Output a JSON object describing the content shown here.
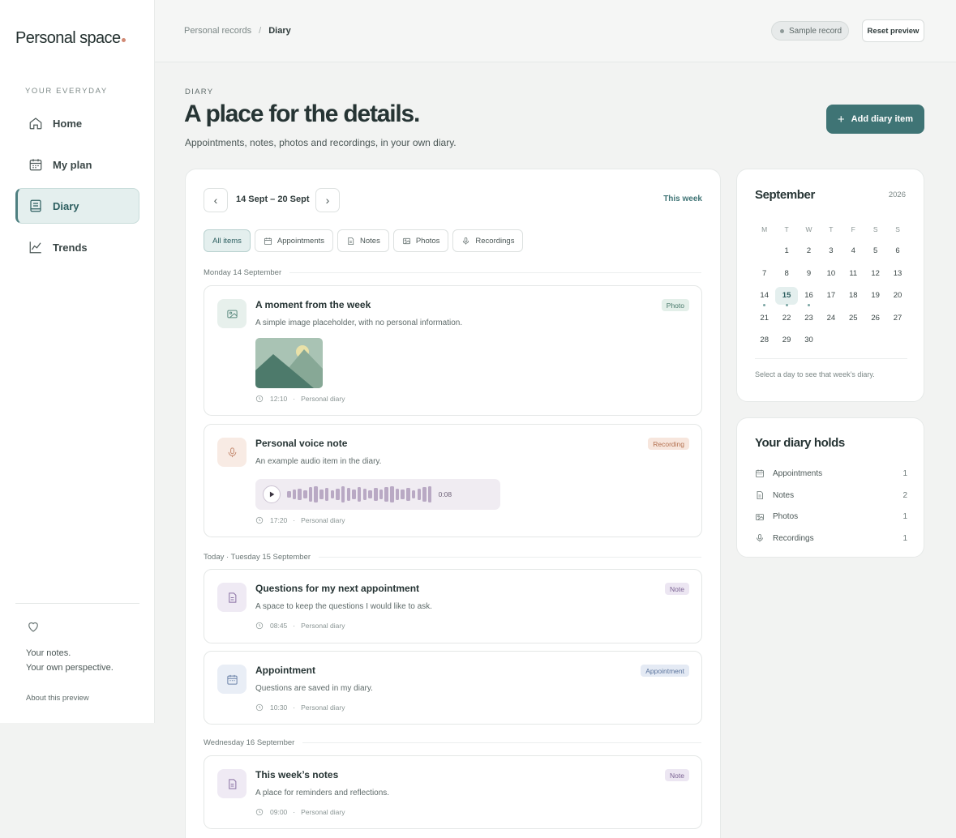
{
  "brand": "Personal space",
  "sidebar": {
    "section_label": "YOUR EVERYDAY",
    "items": [
      {
        "label": "Home",
        "icon": "home-icon"
      },
      {
        "label": "My plan",
        "icon": "calendar-icon"
      },
      {
        "label": "Diary",
        "icon": "book-icon",
        "active": true
      },
      {
        "label": "Trends",
        "icon": "chart-icon"
      }
    ],
    "quote_line1": "Your notes.",
    "quote_line2": "Your own perspective.",
    "about": "About this preview"
  },
  "topbar": {
    "crumb_parent": "Personal records",
    "crumb_sep": "/",
    "crumb_current": "Diary",
    "sample_badge": "Sample record",
    "reset": "Reset preview"
  },
  "header": {
    "eyebrow": "DIARY",
    "title": "A place for the details.",
    "subtitle": "Appointments, notes, photos and recordings, in your own diary.",
    "add_button": "Add diary item"
  },
  "week": {
    "range": "14 Sept – 20 Sept",
    "this_week": "This week"
  },
  "filters": [
    "All items",
    "Appointments",
    "Notes",
    "Photos",
    "Recordings"
  ],
  "days": [
    {
      "label": "Monday 14 September"
    },
    {
      "label": "Today · Tuesday 15 September"
    },
    {
      "label": "Wednesday 16 September"
    }
  ],
  "entries": [
    {
      "title": "A moment from the week",
      "desc": "A simple image placeholder, with no personal information.",
      "tag": "Photo",
      "time": "12:10",
      "source": "Personal diary"
    },
    {
      "title": "Personal voice note",
      "desc": "An example audio item in the diary.",
      "tag": "Recording",
      "time": "17:20",
      "source": "Personal diary",
      "duration": "0:08"
    },
    {
      "title": "Questions for my next appointment",
      "desc": "A space to keep the questions I would like to ask.",
      "tag": "Note",
      "time": "08:45",
      "source": "Personal diary"
    },
    {
      "title": "Appointment",
      "desc": "Questions are saved in my diary.",
      "tag": "Appointment",
      "time": "10:30",
      "source": "Personal diary"
    },
    {
      "title": "This week’s notes",
      "desc": "A place for reminders and reflections.",
      "tag": "Note",
      "time": "09:00",
      "source": "Personal diary"
    }
  ],
  "calendar": {
    "month": "September",
    "year": "2026",
    "weekdays": [
      "M",
      "T",
      "W",
      "T",
      "F",
      "S",
      "S"
    ],
    "weeks": [
      [
        "",
        "1",
        "2",
        "3",
        "4",
        "5",
        "6"
      ],
      [
        "7",
        "8",
        "9",
        "10",
        "11",
        "12",
        "13"
      ],
      [
        "14",
        "15",
        "16",
        "17",
        "18",
        "19",
        "20"
      ],
      [
        "21",
        "22",
        "23",
        "24",
        "25",
        "26",
        "27"
      ],
      [
        "28",
        "29",
        "30",
        "",
        "",
        "",
        ""
      ]
    ],
    "today": "15",
    "marked": [
      "14",
      "15",
      "16"
    ],
    "hint": "Select a day to see that week’s diary."
  },
  "holds": {
    "title": "Your diary holds",
    "rows": [
      {
        "label": "Appointments",
        "count": "1"
      },
      {
        "label": "Notes",
        "count": "2"
      },
      {
        "label": "Photos",
        "count": "1"
      },
      {
        "label": "Recordings",
        "count": "1"
      }
    ]
  },
  "colors": {
    "accent": "#3f7475",
    "photo_tag_bg": "#e3efe9",
    "recording_tag_bg": "#f7e6dd",
    "note_tag_bg": "#ece6f2",
    "appointment_tag_bg": "#e4eaf4"
  }
}
